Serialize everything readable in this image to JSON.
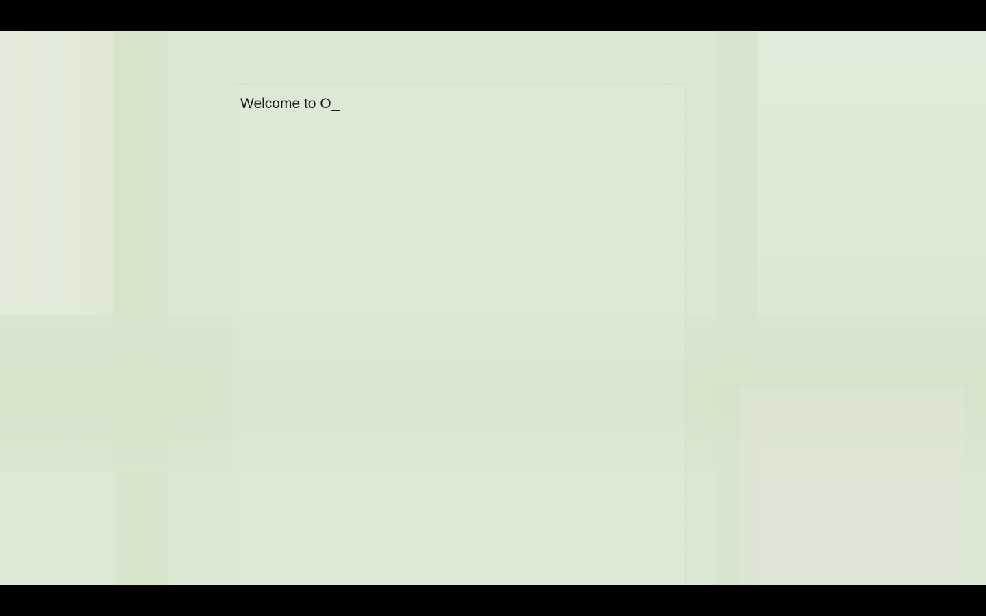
{
  "editor": {
    "typed_text": "Welcome to O",
    "cursor_glyph": "_"
  },
  "colors": {
    "background": "#dce8d3",
    "text": "#1c1c1c",
    "letterbox": "#000000"
  }
}
